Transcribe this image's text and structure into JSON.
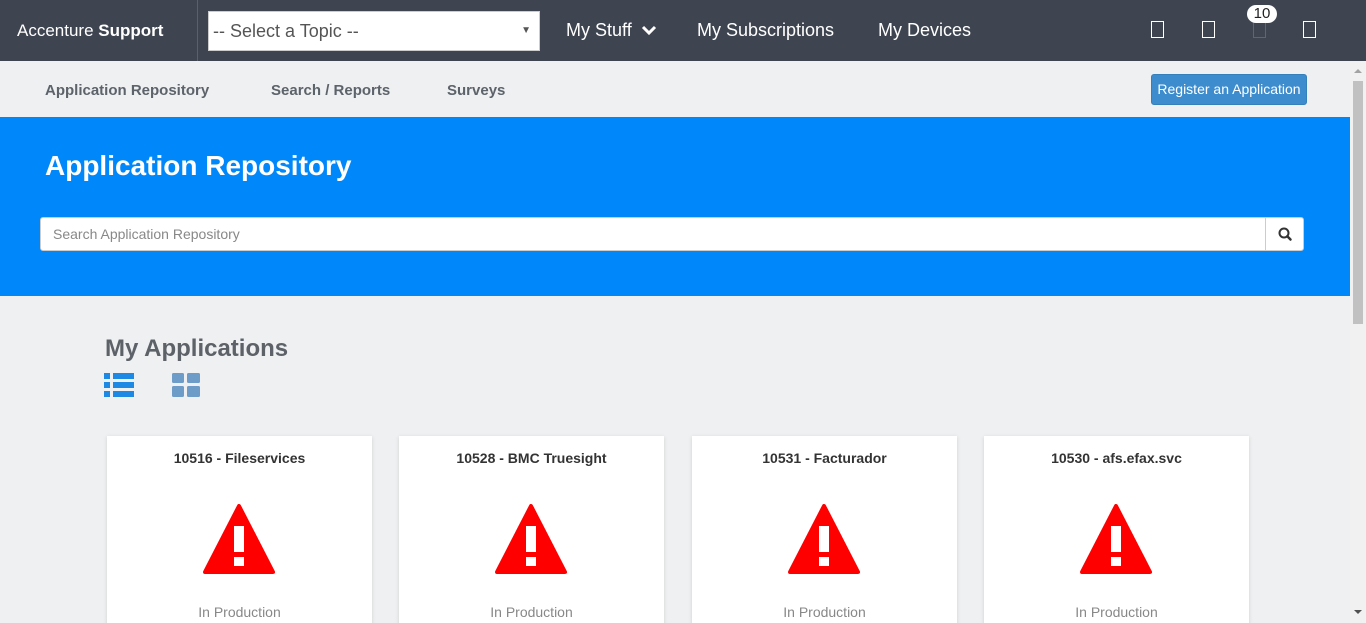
{
  "topbar": {
    "brand_prefix": "Accenture",
    "brand_bold": "Support",
    "topic_select_value": "-- Select a Topic --",
    "nav": [
      "My Stuff",
      "My Subscriptions",
      "My Devices"
    ],
    "notification_count": "10"
  },
  "subnav": {
    "links": [
      "Application Repository",
      "Search / Reports",
      "Surveys"
    ],
    "register_button": "Register an Application"
  },
  "hero": {
    "title": "Application Repository",
    "search_placeholder": "Search Application Repository"
  },
  "main": {
    "section_title": "My Applications",
    "cards": [
      {
        "title": "10516 - Fileservices",
        "status": "In Production"
      },
      {
        "title": "10528 - BMC Truesight",
        "status": "In Production"
      },
      {
        "title": "10531 - Facturador",
        "status": "In Production"
      },
      {
        "title": "10530 - afs.efax.svc",
        "status": "In Production"
      }
    ]
  },
  "colors": {
    "topbar": "#3e4550",
    "hero": "#0088fb",
    "accent_button": "#3d8ccd",
    "warning": "#ff0000"
  },
  "icons": [
    "chevron-down-icon",
    "square-icon",
    "notification-icon",
    "search-icon",
    "list-view-icon",
    "grid-view-icon",
    "warning-icon"
  ]
}
